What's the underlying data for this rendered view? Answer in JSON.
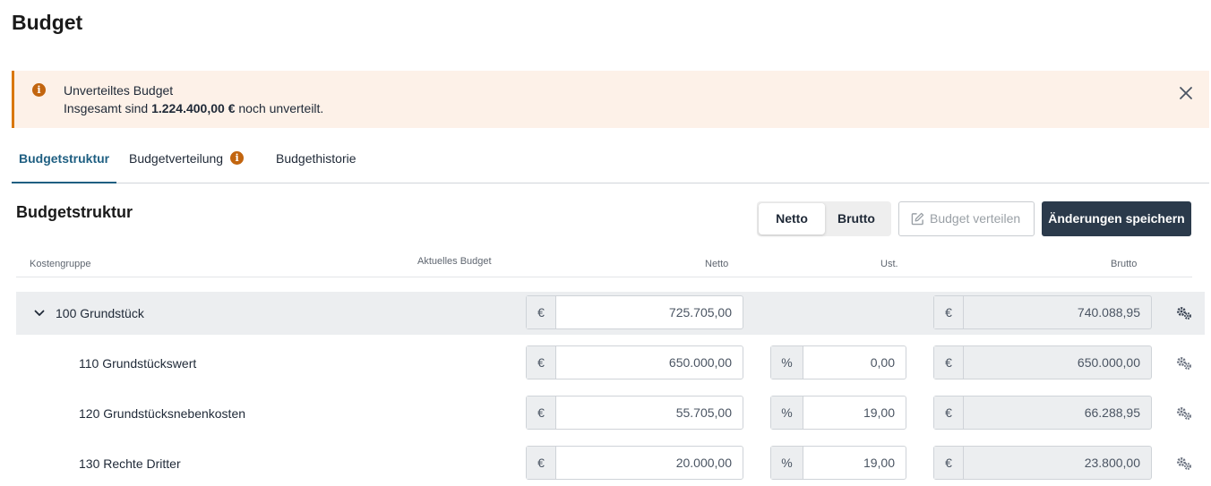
{
  "page": {
    "title": "Budget"
  },
  "alert": {
    "title": "Unverteiltes Budget",
    "text_before": "Insgesamt sind ",
    "amount": "1.224.400,00 €",
    "text_after": " noch unverteilt.",
    "icon": "info-icon",
    "close_icon": "close-icon"
  },
  "tabs": [
    {
      "label": "Budgetstruktur",
      "active": true
    },
    {
      "label": "Budgetverteilung",
      "badge": "i"
    },
    {
      "label": "Budgethistorie"
    }
  ],
  "section": {
    "title": "Budgetstruktur"
  },
  "toggle": {
    "netto": "Netto",
    "brutto": "Brutto",
    "selected": "Netto"
  },
  "buttons": {
    "distribute": "Budget verteilen",
    "save": "Änderungen speichern"
  },
  "columns": {
    "kostengruppe": "Kostengruppe",
    "aktuelles_budget": "Aktuelles Budget",
    "netto": "Netto",
    "ust": "Ust.",
    "brutto": "Brutto"
  },
  "rows": [
    {
      "label": "100 Grundstück",
      "currency": "€",
      "netto": "725.705,00",
      "brutto": "740.088,95"
    },
    {
      "label": "110 Grundstückswert",
      "currency": "€",
      "netto": "650.000,00",
      "ust_unit": "%",
      "ust": "0,00",
      "brutto": "650.000,00"
    },
    {
      "label": "120 Grundstücksnebenkosten",
      "currency": "€",
      "netto": "55.705,00",
      "ust_unit": "%",
      "ust": "19,00",
      "brutto": "66.288,95"
    },
    {
      "label": "130 Rechte Dritter",
      "currency": "€",
      "netto": "20.000,00",
      "ust_unit": "%",
      "ust": "19,00",
      "brutto": "23.800,00"
    }
  ],
  "colors": {
    "accent": "#1f5f82",
    "warning": "#c2650f",
    "alert_bg": "#fdf1e8",
    "dark_button": "#2b3a4b"
  }
}
